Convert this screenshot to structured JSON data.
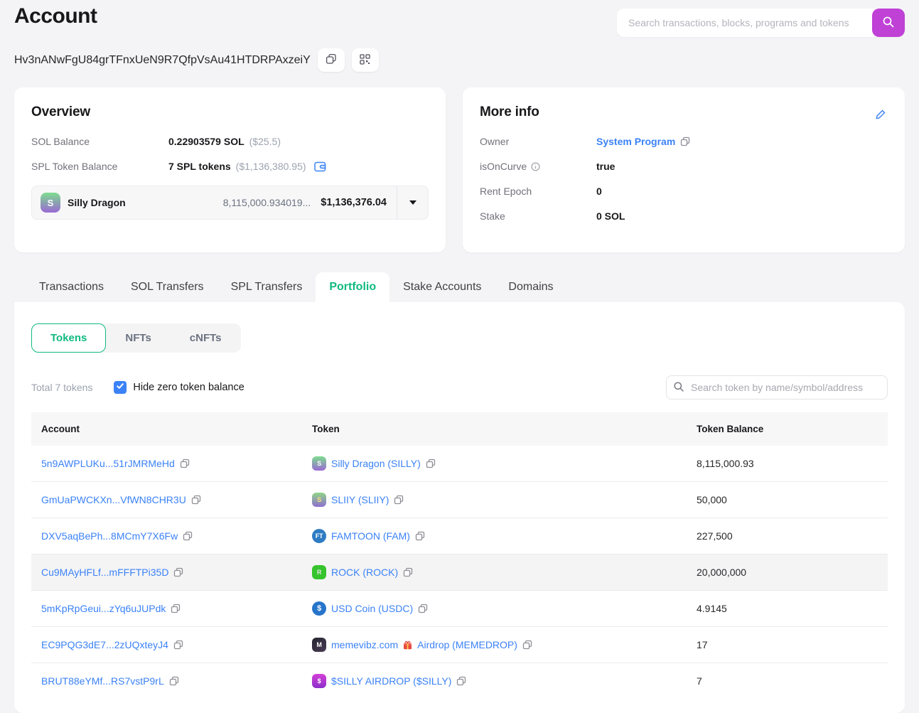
{
  "page": {
    "title": "Account",
    "address": "Hv3nANwFgU84grTFnxUeN9R7QfpVsAu41HTDRPAxzeiY"
  },
  "header_search": {
    "placeholder": "Search transactions, blocks, programs and tokens"
  },
  "overview": {
    "title": "Overview",
    "sol_balance": {
      "label": "SOL Balance",
      "value": "0.22903579 SOL",
      "usd": "($25.5)"
    },
    "spl_balance": {
      "label": "SPL Token Balance",
      "value": "7 SPL tokens",
      "usd": "($1,136,380.95)"
    },
    "token_selector": {
      "name": "Silly Dragon",
      "amount": "8,115,000.934019...",
      "usd": "$1,136,376.04",
      "icon_text": "S"
    }
  },
  "more_info": {
    "title": "More info",
    "owner": {
      "label": "Owner",
      "value": "System Program"
    },
    "is_on_curve": {
      "label": "isOnCurve",
      "value": "true"
    },
    "rent_epoch": {
      "label": "Rent Epoch",
      "value": "0"
    },
    "stake": {
      "label": "Stake",
      "value": "0 SOL"
    }
  },
  "tabs": {
    "items": [
      "Transactions",
      "SOL Transfers",
      "SPL Transfers",
      "Portfolio",
      "Stake Accounts",
      "Domains"
    ],
    "active": "Portfolio"
  },
  "portfolio": {
    "segments": {
      "items": [
        "Tokens",
        "NFTs",
        "cNFTs"
      ],
      "active": "Tokens"
    },
    "total_label": "Total 7 tokens",
    "hide_zero_checked": true,
    "hide_zero_label": "Hide zero token balance",
    "token_search_placeholder": "Search token by name/symbol/address",
    "table": {
      "headers": [
        "Account",
        "Token",
        "Token Balance"
      ],
      "rows": [
        {
          "account": "5n9AWPLUKu...51rJMRMeHd",
          "token": "Silly Dragon (SILLY)",
          "balance": "8,115,000.93",
          "icon": "silly",
          "icon_text": "S"
        },
        {
          "account": "GmUaPWCKXn...VfWN8CHR3U",
          "token": "SLIIY (SLIIY)",
          "balance": "50,000",
          "icon": "sliiy",
          "icon_text": "S"
        },
        {
          "account": "DXV5aqBePh...8MCmY7X6Fw",
          "token": "FAMTOON (FAM)",
          "balance": "227,500",
          "icon": "famtoon",
          "icon_text": "FT"
        },
        {
          "account": "Cu9MAyHFLf...mFFFTPi35D",
          "token": "ROCK (ROCK)",
          "balance": "20,000,000",
          "icon": "rock",
          "icon_text": "R",
          "highlighted": true
        },
        {
          "account": "5mKpRpGeui...zYq6uJUPdk",
          "token": "USD Coin (USDC)",
          "balance": "4.9145",
          "icon": "usdc",
          "icon_text": "$"
        },
        {
          "account": "EC9PQG3dE7...2zUQxteyJ4",
          "token": "memevibz.com",
          "token_suffix": "Airdrop (MEMEDROP)",
          "gift_icon": true,
          "balance": "17",
          "icon": "memevibz",
          "icon_text": "M"
        },
        {
          "account": "BRUT88eYMf...RS7vstP9rL",
          "token": "$SILLY AIRDROP ($SILLY)",
          "balance": "7",
          "icon": "ssilly",
          "icon_text": "$"
        }
      ]
    }
  },
  "colors": {
    "accent_purple": "#bf41d6",
    "accent_green": "#10b981",
    "link_blue": "#3b82f6"
  }
}
